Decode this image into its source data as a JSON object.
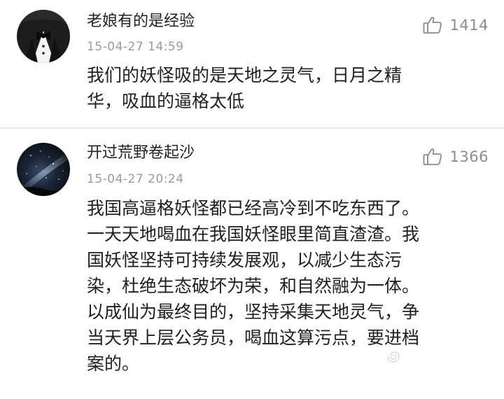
{
  "comments": [
    {
      "username": "老娘有的是经验",
      "timestamp": "15-04-27 14:59",
      "likes": "1414",
      "avatar_icon": "tuxedo-bowtie-avatar",
      "text_lines": [
        "我们的妖怪吸的是天地之灵气，日月之精",
        "华，吸血的逼格太低"
      ]
    },
    {
      "username": "开过荒野卷起沙",
      "timestamp": "15-04-27 20:24",
      "likes": "1366",
      "avatar_icon": "starry-night-avatar",
      "text_lines": [
        "我国高逼格妖怪都已经高冷到不吃东西了。",
        "一天天地喝血在我国妖怪眼里简直渣渣。我",
        "国妖怪坚持可持续发展观，以减少生态污",
        "染，杜绝生态破坏为荣，和自然融为一体。",
        "以成仙为最终目的，坚持采集天地灵气，争",
        "当天界上层公务员，喝血这算污点，要进档",
        "案的。"
      ]
    }
  ],
  "colors": {
    "username": "#222222",
    "timestamp": "#9a9a9a",
    "like_count": "#8c8c8c",
    "divider": "#e6e6e6"
  }
}
